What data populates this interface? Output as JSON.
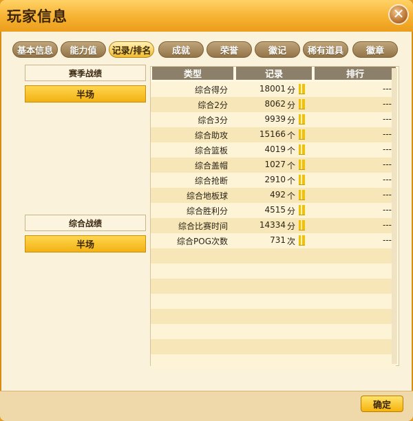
{
  "window": {
    "title": "玩家信息"
  },
  "tabs": [
    {
      "label": "基本信息",
      "active": false
    },
    {
      "label": "能力值",
      "active": false
    },
    {
      "label": "记录/排名",
      "active": true
    },
    {
      "label": "成就",
      "active": false
    },
    {
      "label": "荣誉",
      "active": false
    },
    {
      "label": "徽记",
      "active": false
    },
    {
      "label": "稀有道具",
      "active": false
    },
    {
      "label": "徽章",
      "active": false
    }
  ],
  "left_panel": {
    "season_header": "赛季战绩",
    "season_button": "半场",
    "overall_header": "综合战绩",
    "overall_button": "半场"
  },
  "table": {
    "columns": [
      "类型",
      "记录",
      "排行"
    ],
    "rows": [
      {
        "type": "综合得分",
        "value": "18001",
        "unit": "分",
        "rank": "---"
      },
      {
        "type": "综合2分",
        "value": "8062",
        "unit": "分",
        "rank": "---"
      },
      {
        "type": "综合3分",
        "value": "9939",
        "unit": "分",
        "rank": "---"
      },
      {
        "type": "综合助攻",
        "value": "15166",
        "unit": "个",
        "rank": "---"
      },
      {
        "type": "综合篮板",
        "value": "4019",
        "unit": "个",
        "rank": "---"
      },
      {
        "type": "综合盖帽",
        "value": "1027",
        "unit": "个",
        "rank": "---"
      },
      {
        "type": "综合抢断",
        "value": "2910",
        "unit": "个",
        "rank": "---"
      },
      {
        "type": "综合地板球",
        "value": "492",
        "unit": "个",
        "rank": "---"
      },
      {
        "type": "综合胜利分",
        "value": "4515",
        "unit": "分",
        "rank": "---"
      },
      {
        "type": "综合比赛时间",
        "value": "14334",
        "unit": "分",
        "rank": "---"
      },
      {
        "type": "综合POG次数",
        "value": "731",
        "unit": "次",
        "rank": "---"
      }
    ],
    "empty_rows": 8
  },
  "footer": {
    "confirm_label": "确定"
  },
  "colors": {
    "accent": "#f2b214",
    "title_bar": "#f6b131",
    "header": "#8c806a"
  }
}
